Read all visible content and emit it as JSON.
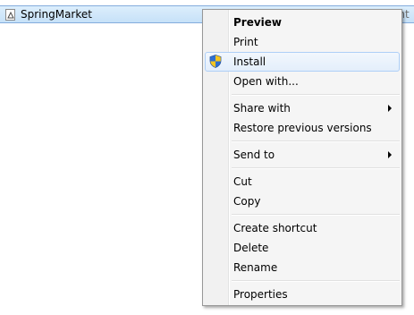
{
  "explorer": {
    "file_name": "SpringMarket",
    "file_icon": "document-icon",
    "right_column_text": "ont"
  },
  "menu": {
    "items": [
      {
        "label": "Preview"
      },
      {
        "label": "Print"
      },
      {
        "label": "Install",
        "icon": "uac-shield-icon"
      },
      {
        "label": "Open with..."
      },
      {
        "label": "Share with",
        "submenu": true
      },
      {
        "label": "Restore previous versions"
      },
      {
        "label": "Send to",
        "submenu": true
      },
      {
        "label": "Cut"
      },
      {
        "label": "Copy"
      },
      {
        "label": "Create shortcut"
      },
      {
        "label": "Delete"
      },
      {
        "label": "Rename"
      },
      {
        "label": "Properties"
      }
    ],
    "highlighted_item": "Install"
  },
  "colors": {
    "selection_fill": "#cce4f8",
    "menu_background": "#f5f5f5",
    "hover_border": "#aecff7"
  }
}
